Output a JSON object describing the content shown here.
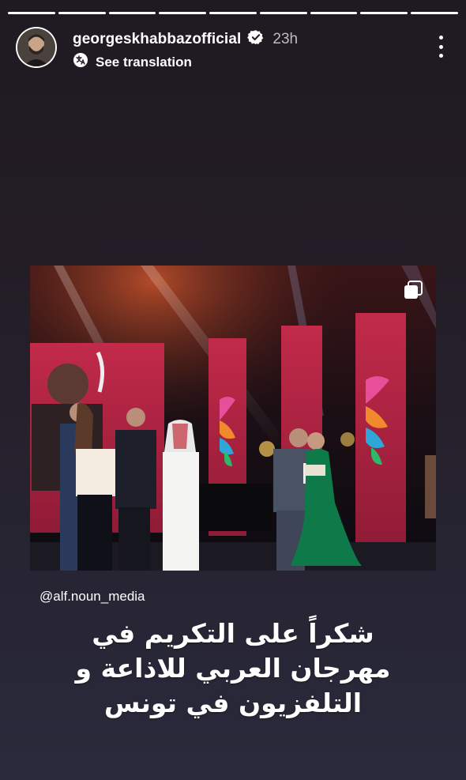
{
  "story": {
    "progress_segments": 9,
    "progress_completed": 9
  },
  "header": {
    "username": "georgeskhabbazofficial",
    "verified_icon": "verified-badge-icon",
    "time_ago": "23h",
    "translate_label": "See translation",
    "translate_icon": "translate-icon",
    "more_icon": "more-options-icon"
  },
  "photo": {
    "carousel_icon": "multiple-images-icon"
  },
  "mention": "@alf.noun_media",
  "caption": {
    "line1": "شكراً على التكريم في",
    "line2": "مهرجان العربي للاذاعة و",
    "line3": "التلفزيون في تونس"
  },
  "colors": {
    "background": "#241e27",
    "stage_pink": "#b3213f",
    "dress_green": "#0e7a4a",
    "verified": "#ffffff"
  }
}
